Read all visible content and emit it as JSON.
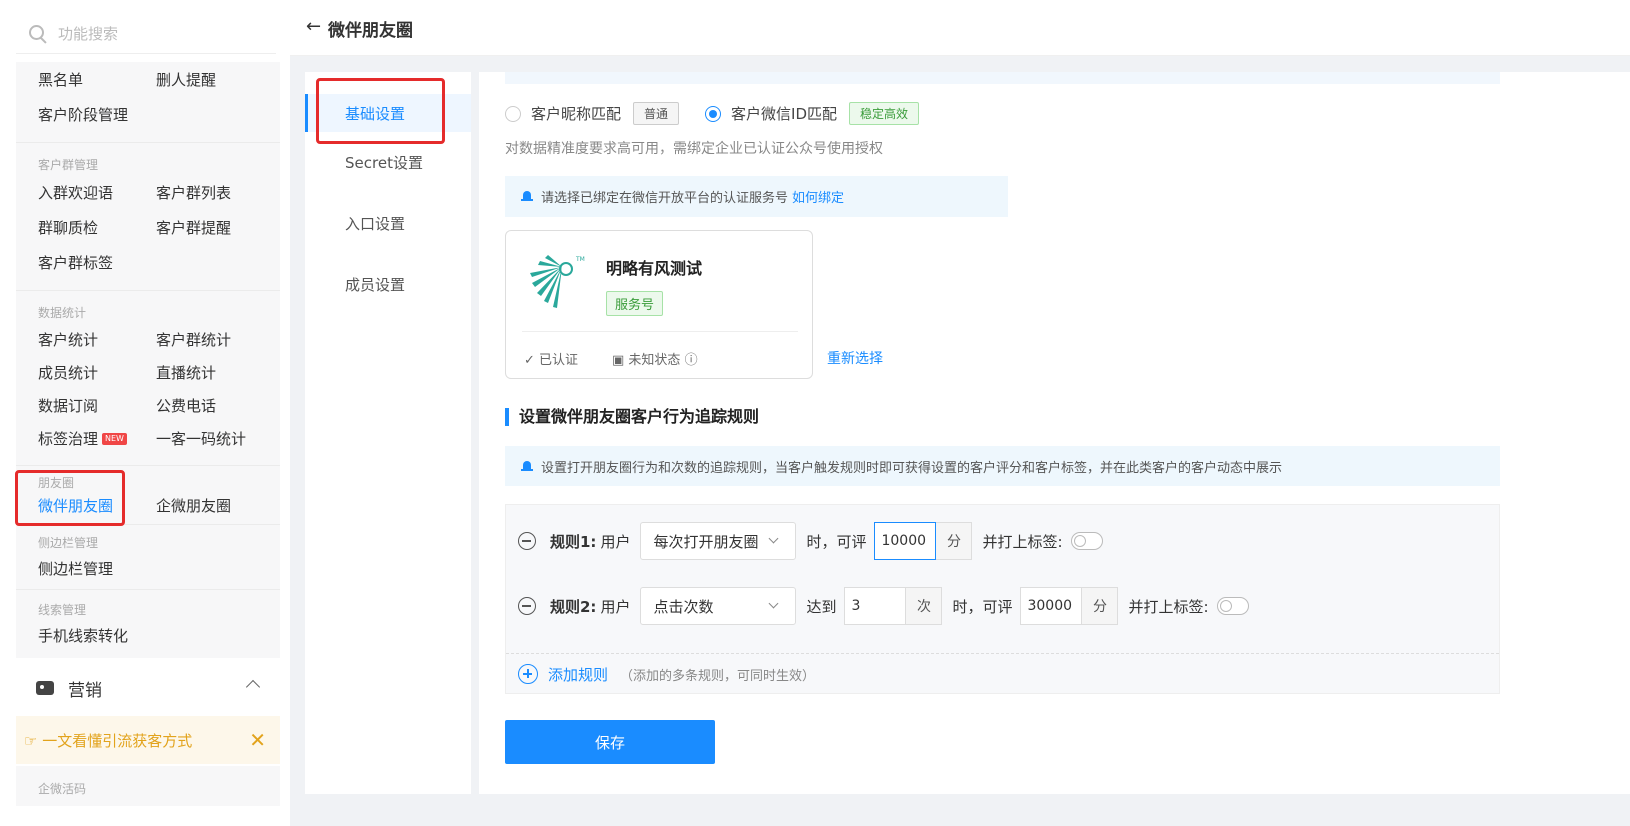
{
  "search": {
    "placeholder": "功能搜索"
  },
  "sidebar": {
    "group0": {
      "items": [
        "黑名单",
        "删人提醒",
        "客户阶段管理"
      ]
    },
    "group_customer_group": {
      "title": "客户群管理",
      "items": [
        "入群欢迎语",
        "客户群列表",
        "群聊质检",
        "客户群提醒",
        "客户群标签"
      ]
    },
    "group_stats": {
      "title": "数据统计",
      "items": [
        "客户统计",
        "客户群统计",
        "成员统计",
        "直播统计",
        "数据订阅",
        "公费电话",
        "标签治理",
        "一客一码统计"
      ],
      "new_badge": "NEW"
    },
    "group_moments": {
      "title": "朋友圈",
      "items": [
        "微伴朋友圈",
        "企微朋友圈"
      ]
    },
    "group_sidebar": {
      "title": "侧边栏管理",
      "items": [
        "侧边栏管理"
      ]
    },
    "group_leads": {
      "title": "线索管理",
      "items": [
        "手机线索转化"
      ]
    },
    "marketing": {
      "label": "营销"
    },
    "tip": {
      "text": "☞ 一文看懂引流获客方式",
      "close": "✕"
    },
    "last_group_title": "企微活码"
  },
  "header": {
    "back": "←",
    "title": "微伴朋友圈"
  },
  "tabs": [
    "基础设置",
    "Secret设置",
    "入口设置",
    "成员设置"
  ],
  "match": {
    "option1": "客户昵称匹配",
    "option1_tag": "普通",
    "option2": "客户微信ID匹配",
    "option2_tag": "稳定高效",
    "desc": "对数据精准度要求高可用，需绑定企业已认证公众号使用授权"
  },
  "notice1": {
    "text": "请选择已绑定在微信开放平台的认证服务号",
    "link": "如何绑定"
  },
  "account": {
    "name": "明略有风测试",
    "type": "服务号",
    "status1": "已认证",
    "status2": "未知状态",
    "reselect": "重新选择"
  },
  "section": {
    "title": "设置微伴朋友圈客户行为追踪规则",
    "notice": "设置打开朋友圈行为和次数的追踪规则，当客户触发规则时即可获得设置的客户评分和客户标签，并在此类客户的客户动态中展示"
  },
  "rules": [
    {
      "label": "规则1:",
      "user": "用户",
      "action": "每次打开朋友圈",
      "when": "时，可评",
      "score": "10000",
      "unit": "分",
      "tag_label": "并打上标签:"
    },
    {
      "label": "规则2:",
      "user": "用户",
      "action": "点击次数",
      "reach": "达到",
      "count": "3",
      "count_unit": "次",
      "when": "时，可评",
      "score": "30000",
      "unit": "分",
      "tag_label": "并打上标签:"
    }
  ],
  "add_rule": {
    "label": "添加规则",
    "note": "（添加的多条规则，可同时生效）"
  },
  "save_label": "保存",
  "colors": {
    "primary": "#1a8cff",
    "highlight_box": "#e52b2b",
    "tip": "#e2a31c"
  }
}
